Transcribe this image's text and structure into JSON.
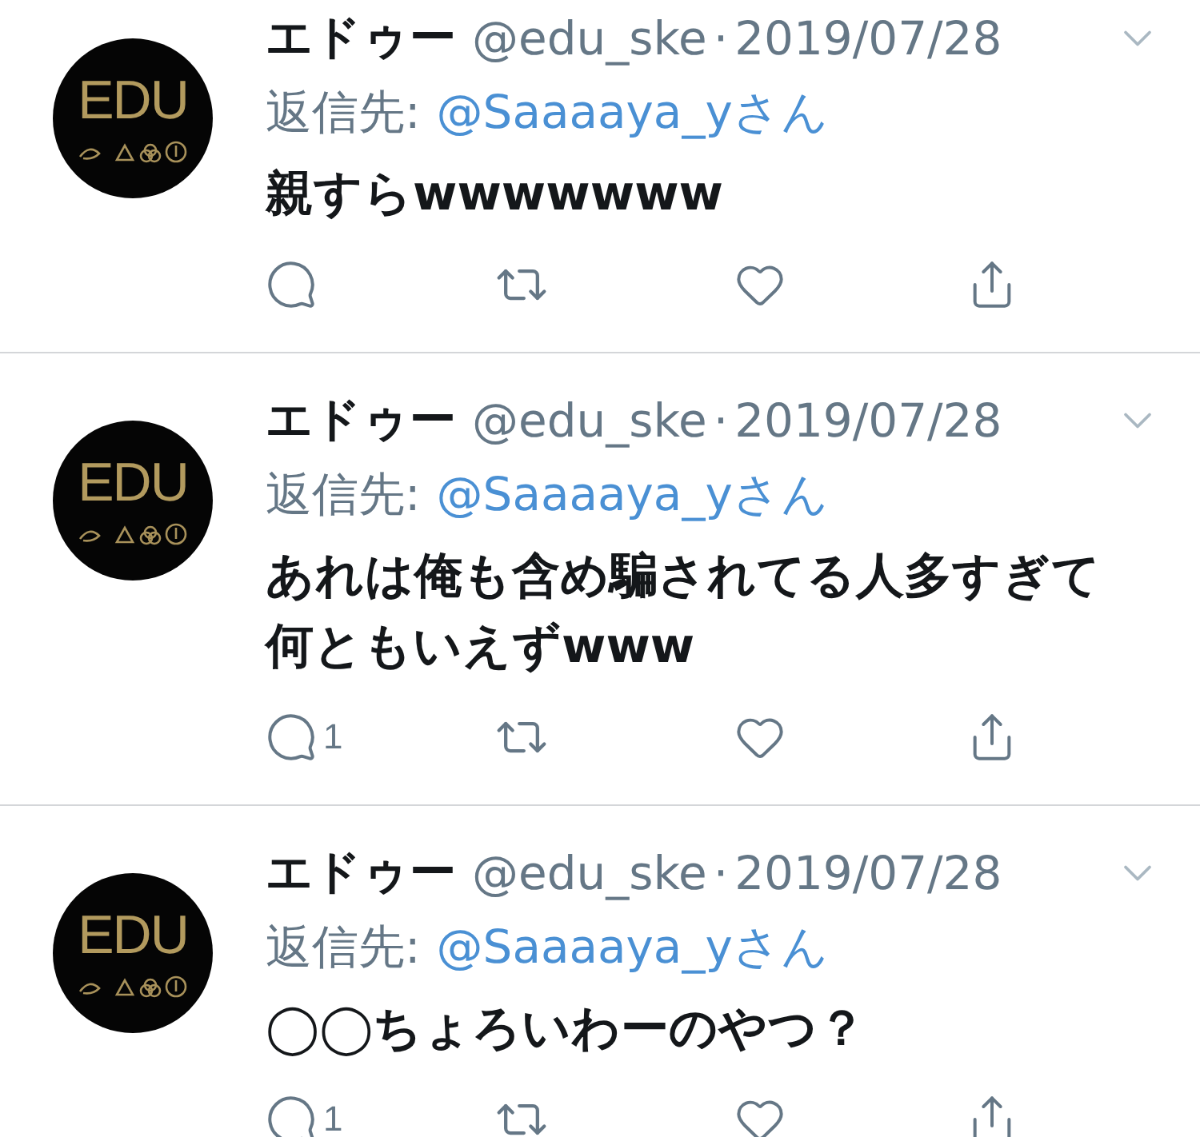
{
  "tweets": [
    {
      "avatar": {
        "logo_text": "EDU"
      },
      "name": "エドゥー",
      "handle": "@edu_ske",
      "separator": "·",
      "date": "2019/07/28",
      "reply_label": "返信先:",
      "reply_to": "@Saaaaya_yさん",
      "body": "親すらwwwwwww"
    },
    {
      "avatar": {
        "logo_text": "EDU"
      },
      "name": "エドゥー",
      "handle": "@edu_ske",
      "separator": "·",
      "date": "2019/07/28",
      "reply_label": "返信先:",
      "reply_to": "@Saaaaya_yさん",
      "body": "あれは俺も含め騙されてる人多すぎて何ともいえずwww",
      "reply_count": "1"
    },
    {
      "avatar": {
        "logo_text": "EDU"
      },
      "name": "エドゥー",
      "handle": "@edu_ske",
      "separator": "·",
      "date": "2019/07/28",
      "reply_label": "返信先:",
      "reply_to": "@Saaaaya_yさん",
      "body": "◯◯ちょろいわーのやつ？",
      "reply_count": "1"
    }
  ]
}
